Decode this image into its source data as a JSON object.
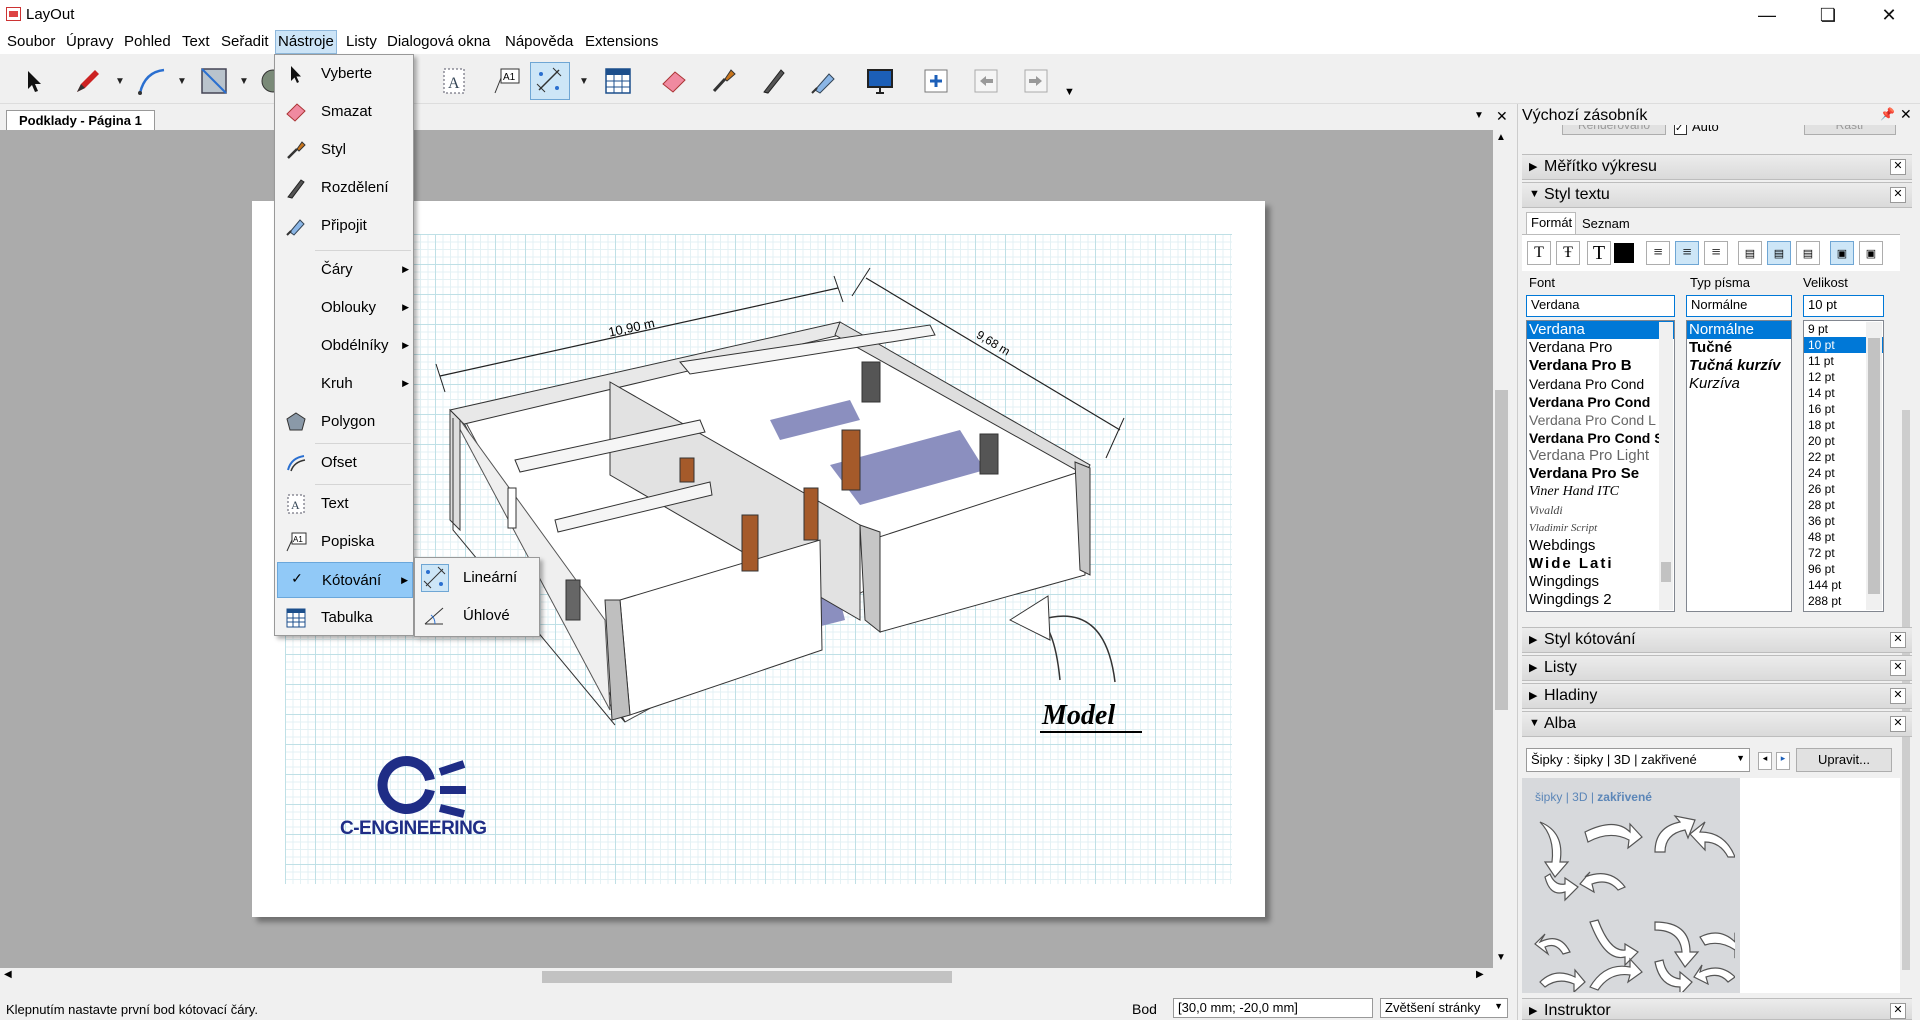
{
  "window": {
    "title": "LayOut"
  },
  "menubar": [
    "Soubor",
    "Úpravy",
    "Pohled",
    "Text",
    "Seřadit",
    "Nástroje",
    "Listy",
    "Dialogová okna",
    "Nápověda",
    "Extensions"
  ],
  "doc_tab": "Podklady - Página 1",
  "tools_menu": {
    "items": [
      "Vyberte",
      "Smazat",
      "Styl",
      "Rozdělení",
      "Připojit",
      "Čáry",
      "Oblouky",
      "Obdélníky",
      "Kruh",
      "Polygon",
      "Ofset",
      "Text",
      "Popiska",
      "Kótování",
      "Tabulka"
    ],
    "checked": "Kótování"
  },
  "dimension_submenu": [
    "Lineární",
    "Úhlové"
  ],
  "drawing": {
    "dim_length": "10,90 m",
    "dim_width": "9,68 m",
    "model_label": "Model",
    "logo_text": "C-ENGINEERING"
  },
  "panel": {
    "title": "Výchozí zásobník",
    "partial_row": {
      "rendered": "Renderováno",
      "auto": "Auto",
      "raster": "Rastr"
    },
    "sections": {
      "scale": "Měřítko výkresu",
      "text_style": "Styl textu",
      "dim_style": "Styl kótování",
      "pages": "Listy",
      "layers": "Hladiny",
      "scrapbooks": "Alba",
      "instructor": "Instruktor"
    },
    "text_tabs": [
      "Formát",
      "Seznam"
    ],
    "font_label": "Font",
    "typeface_label": "Typ písma",
    "size_label": "Velikost",
    "font_value": "Verdana",
    "typeface_value": "Normálne",
    "size_value": "10 pt",
    "fonts": [
      "Verdana",
      "Verdana Pro",
      "Verdana Pro B",
      "Verdana Pro Cond",
      "Verdana Pro Cond",
      "Verdana Pro Cond L",
      "Verdana Pro Cond S",
      "Verdana Pro Light",
      "Verdana Pro Se",
      "Viner Hand ITC",
      "Vivaldi",
      "Vladimir Script",
      "Webdings",
      "Wide Lati",
      "Wingdings",
      "Wingdings 2"
    ],
    "typefaces": [
      "Normálne",
      "Tučné",
      "Tučná kurzív",
      "Kurzíva"
    ],
    "sizes": [
      "9 pt",
      "10 pt",
      "11 pt",
      "12 pt",
      "14 pt",
      "16 pt",
      "18 pt",
      "20 pt",
      "22 pt",
      "24 pt",
      "26 pt",
      "28 pt",
      "36 pt",
      "48 pt",
      "72 pt",
      "96 pt",
      "144 pt",
      "288 pt"
    ],
    "scrapbook_select": "Šipky : šipky | 3D | zakřivené",
    "edit_button": "Upravit...",
    "scrapbook_header": {
      "a": "šipky",
      "b": "3D",
      "c": "zakřivené"
    }
  },
  "status": {
    "message": "Klepnutím nastavte první bod kótovací čáry.",
    "point_label": "Bod",
    "coords": "[30,0 mm; -20,0 mm]",
    "zoom": "Zvětšení stránky"
  },
  "colors": {
    "selection": "#0078d7",
    "menu_highlight": "#91c9f7",
    "logo": "#1f2d86"
  }
}
